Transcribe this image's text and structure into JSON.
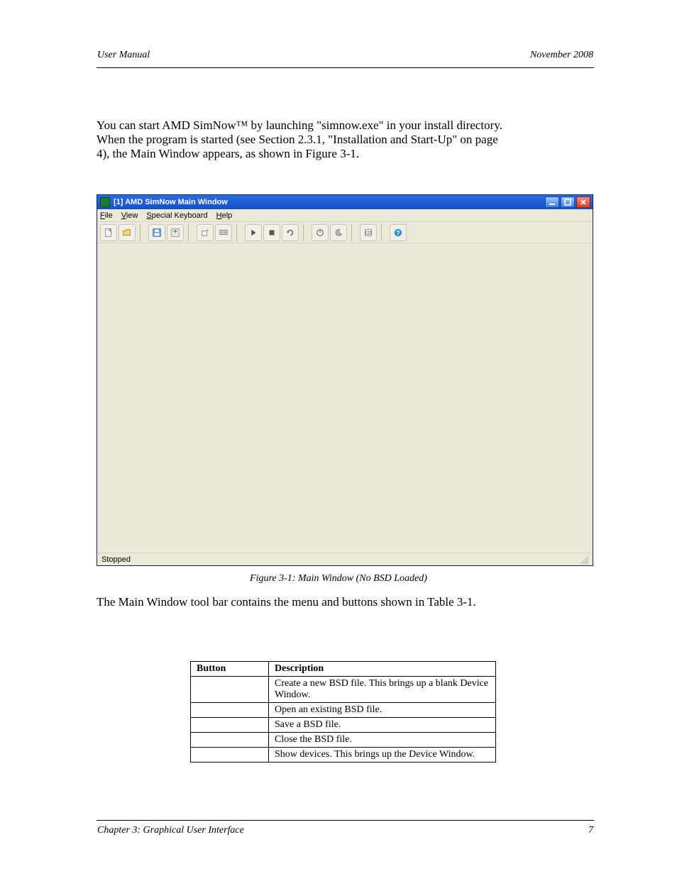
{
  "header": {
    "left": "User Manual",
    "right": "November 2008"
  },
  "intro": {
    "line1": "You can start AMD SimNow™ by launching \"simnow.exe\" in your install directory.",
    "line2": "When the program is started (see Section 2.3.1, \"Installation and Start-Up\" on page",
    "line3": "4), the Main Window appears, as shown in Figure 3-1."
  },
  "window": {
    "title": "[1] AMD SimNow Main Window",
    "menus": {
      "file": "File",
      "view": "View",
      "special": "Special Keyboard",
      "help": "Help"
    },
    "status": "Stopped"
  },
  "icons": {
    "new_bsd": "new-bsd-icon",
    "open_bsd": "open-bsd-icon",
    "save_bsd": "save-bsd-icon",
    "close_bsd": "close-bsd-icon",
    "configure": "configure-icon",
    "devices": "devices-icon",
    "play": "play-icon",
    "stop": "stop-icon",
    "reset": "reset-icon",
    "power": "power-icon",
    "sleep": "sleep-icon",
    "numeric": "numeric-icon",
    "help": "help-icon"
  },
  "caption": "Figure 3-1: Main Window (No BSD Loaded)",
  "tb_desc_head": "The Main Window tool bar contains the menu and buttons shown in Table 3-1.",
  "table": {
    "head": {
      "button": "Button",
      "desc": "Description"
    },
    "rows": [
      {
        "button": "",
        "desc": "Create a new BSD file. This brings up a blank Device Window."
      },
      {
        "button": "",
        "desc": "Open an existing BSD file."
      },
      {
        "button": "",
        "desc": "Save a BSD file."
      },
      {
        "button": "",
        "desc": "Close the BSD file."
      },
      {
        "button": "",
        "desc": "Show devices. This brings up the Device Window."
      }
    ]
  },
  "footer": {
    "left": "Chapter 3: Graphical User Interface",
    "right": "7"
  }
}
